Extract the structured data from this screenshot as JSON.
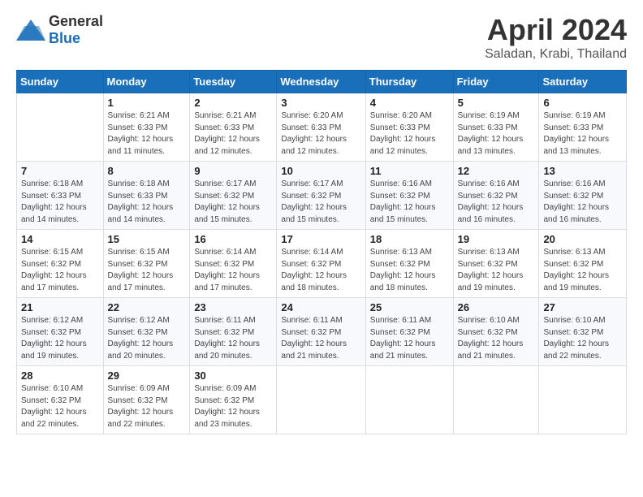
{
  "header": {
    "logo_general": "General",
    "logo_blue": "Blue",
    "title": "April 2024",
    "location": "Saladan, Krabi, Thailand"
  },
  "weekdays": [
    "Sunday",
    "Monday",
    "Tuesday",
    "Wednesday",
    "Thursday",
    "Friday",
    "Saturday"
  ],
  "weeks": [
    [
      {
        "day": "",
        "sunrise": "",
        "sunset": "",
        "daylight": ""
      },
      {
        "day": "1",
        "sunrise": "Sunrise: 6:21 AM",
        "sunset": "Sunset: 6:33 PM",
        "daylight": "Daylight: 12 hours and 11 minutes."
      },
      {
        "day": "2",
        "sunrise": "Sunrise: 6:21 AM",
        "sunset": "Sunset: 6:33 PM",
        "daylight": "Daylight: 12 hours and 12 minutes."
      },
      {
        "day": "3",
        "sunrise": "Sunrise: 6:20 AM",
        "sunset": "Sunset: 6:33 PM",
        "daylight": "Daylight: 12 hours and 12 minutes."
      },
      {
        "day": "4",
        "sunrise": "Sunrise: 6:20 AM",
        "sunset": "Sunset: 6:33 PM",
        "daylight": "Daylight: 12 hours and 12 minutes."
      },
      {
        "day": "5",
        "sunrise": "Sunrise: 6:19 AM",
        "sunset": "Sunset: 6:33 PM",
        "daylight": "Daylight: 12 hours and 13 minutes."
      },
      {
        "day": "6",
        "sunrise": "Sunrise: 6:19 AM",
        "sunset": "Sunset: 6:33 PM",
        "daylight": "Daylight: 12 hours and 13 minutes."
      }
    ],
    [
      {
        "day": "7",
        "sunrise": "Sunrise: 6:18 AM",
        "sunset": "Sunset: 6:33 PM",
        "daylight": "Daylight: 12 hours and 14 minutes."
      },
      {
        "day": "8",
        "sunrise": "Sunrise: 6:18 AM",
        "sunset": "Sunset: 6:33 PM",
        "daylight": "Daylight: 12 hours and 14 minutes."
      },
      {
        "day": "9",
        "sunrise": "Sunrise: 6:17 AM",
        "sunset": "Sunset: 6:32 PM",
        "daylight": "Daylight: 12 hours and 15 minutes."
      },
      {
        "day": "10",
        "sunrise": "Sunrise: 6:17 AM",
        "sunset": "Sunset: 6:32 PM",
        "daylight": "Daylight: 12 hours and 15 minutes."
      },
      {
        "day": "11",
        "sunrise": "Sunrise: 6:16 AM",
        "sunset": "Sunset: 6:32 PM",
        "daylight": "Daylight: 12 hours and 15 minutes."
      },
      {
        "day": "12",
        "sunrise": "Sunrise: 6:16 AM",
        "sunset": "Sunset: 6:32 PM",
        "daylight": "Daylight: 12 hours and 16 minutes."
      },
      {
        "day": "13",
        "sunrise": "Sunrise: 6:16 AM",
        "sunset": "Sunset: 6:32 PM",
        "daylight": "Daylight: 12 hours and 16 minutes."
      }
    ],
    [
      {
        "day": "14",
        "sunrise": "Sunrise: 6:15 AM",
        "sunset": "Sunset: 6:32 PM",
        "daylight": "Daylight: 12 hours and 17 minutes."
      },
      {
        "day": "15",
        "sunrise": "Sunrise: 6:15 AM",
        "sunset": "Sunset: 6:32 PM",
        "daylight": "Daylight: 12 hours and 17 minutes."
      },
      {
        "day": "16",
        "sunrise": "Sunrise: 6:14 AM",
        "sunset": "Sunset: 6:32 PM",
        "daylight": "Daylight: 12 hours and 17 minutes."
      },
      {
        "day": "17",
        "sunrise": "Sunrise: 6:14 AM",
        "sunset": "Sunset: 6:32 PM",
        "daylight": "Daylight: 12 hours and 18 minutes."
      },
      {
        "day": "18",
        "sunrise": "Sunrise: 6:13 AM",
        "sunset": "Sunset: 6:32 PM",
        "daylight": "Daylight: 12 hours and 18 minutes."
      },
      {
        "day": "19",
        "sunrise": "Sunrise: 6:13 AM",
        "sunset": "Sunset: 6:32 PM",
        "daylight": "Daylight: 12 hours and 19 minutes."
      },
      {
        "day": "20",
        "sunrise": "Sunrise: 6:13 AM",
        "sunset": "Sunset: 6:32 PM",
        "daylight": "Daylight: 12 hours and 19 minutes."
      }
    ],
    [
      {
        "day": "21",
        "sunrise": "Sunrise: 6:12 AM",
        "sunset": "Sunset: 6:32 PM",
        "daylight": "Daylight: 12 hours and 19 minutes."
      },
      {
        "day": "22",
        "sunrise": "Sunrise: 6:12 AM",
        "sunset": "Sunset: 6:32 PM",
        "daylight": "Daylight: 12 hours and 20 minutes."
      },
      {
        "day": "23",
        "sunrise": "Sunrise: 6:11 AM",
        "sunset": "Sunset: 6:32 PM",
        "daylight": "Daylight: 12 hours and 20 minutes."
      },
      {
        "day": "24",
        "sunrise": "Sunrise: 6:11 AM",
        "sunset": "Sunset: 6:32 PM",
        "daylight": "Daylight: 12 hours and 21 minutes."
      },
      {
        "day": "25",
        "sunrise": "Sunrise: 6:11 AM",
        "sunset": "Sunset: 6:32 PM",
        "daylight": "Daylight: 12 hours and 21 minutes."
      },
      {
        "day": "26",
        "sunrise": "Sunrise: 6:10 AM",
        "sunset": "Sunset: 6:32 PM",
        "daylight": "Daylight: 12 hours and 21 minutes."
      },
      {
        "day": "27",
        "sunrise": "Sunrise: 6:10 AM",
        "sunset": "Sunset: 6:32 PM",
        "daylight": "Daylight: 12 hours and 22 minutes."
      }
    ],
    [
      {
        "day": "28",
        "sunrise": "Sunrise: 6:10 AM",
        "sunset": "Sunset: 6:32 PM",
        "daylight": "Daylight: 12 hours and 22 minutes."
      },
      {
        "day": "29",
        "sunrise": "Sunrise: 6:09 AM",
        "sunset": "Sunset: 6:32 PM",
        "daylight": "Daylight: 12 hours and 22 minutes."
      },
      {
        "day": "30",
        "sunrise": "Sunrise: 6:09 AM",
        "sunset": "Sunset: 6:32 PM",
        "daylight": "Daylight: 12 hours and 23 minutes."
      },
      {
        "day": "",
        "sunrise": "",
        "sunset": "",
        "daylight": ""
      },
      {
        "day": "",
        "sunrise": "",
        "sunset": "",
        "daylight": ""
      },
      {
        "day": "",
        "sunrise": "",
        "sunset": "",
        "daylight": ""
      },
      {
        "day": "",
        "sunrise": "",
        "sunset": "",
        "daylight": ""
      }
    ]
  ]
}
